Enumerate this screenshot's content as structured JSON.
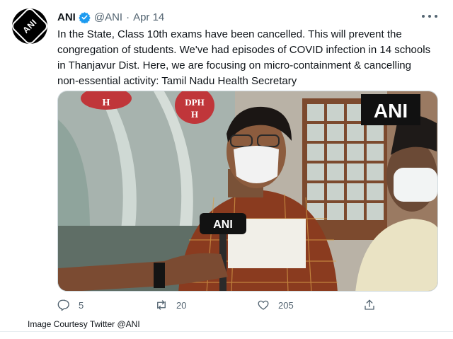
{
  "author": {
    "name": "ANI",
    "handle": "@ANI",
    "separator": "·",
    "date": "Apr 14",
    "avatar_text": "ANI"
  },
  "tweet_text": "In the State, Class 10th exams have been cancelled. This will prevent the congregation of students. We've had episodes of COVID infection in 14 schools in Thanjavur Dist. Here, we are focusing on micro-containment & cancelling non-essential activity: Tamil Nadu Health Secretary",
  "media": {
    "watermark": "ANI",
    "mic_label": "ANI",
    "sign_top": "H",
    "sign_dph": "DPH",
    "sign_h2": "H"
  },
  "actions": {
    "replies": "5",
    "retweets": "20",
    "likes": "205"
  },
  "caption": "Image Courtesy Twitter @ANI",
  "colors": {
    "verified": "#1d9bf0",
    "muted": "#536471"
  },
  "icons": [
    "more-icon",
    "verified-icon",
    "reply-icon",
    "retweet-icon",
    "like-icon",
    "share-icon"
  ]
}
